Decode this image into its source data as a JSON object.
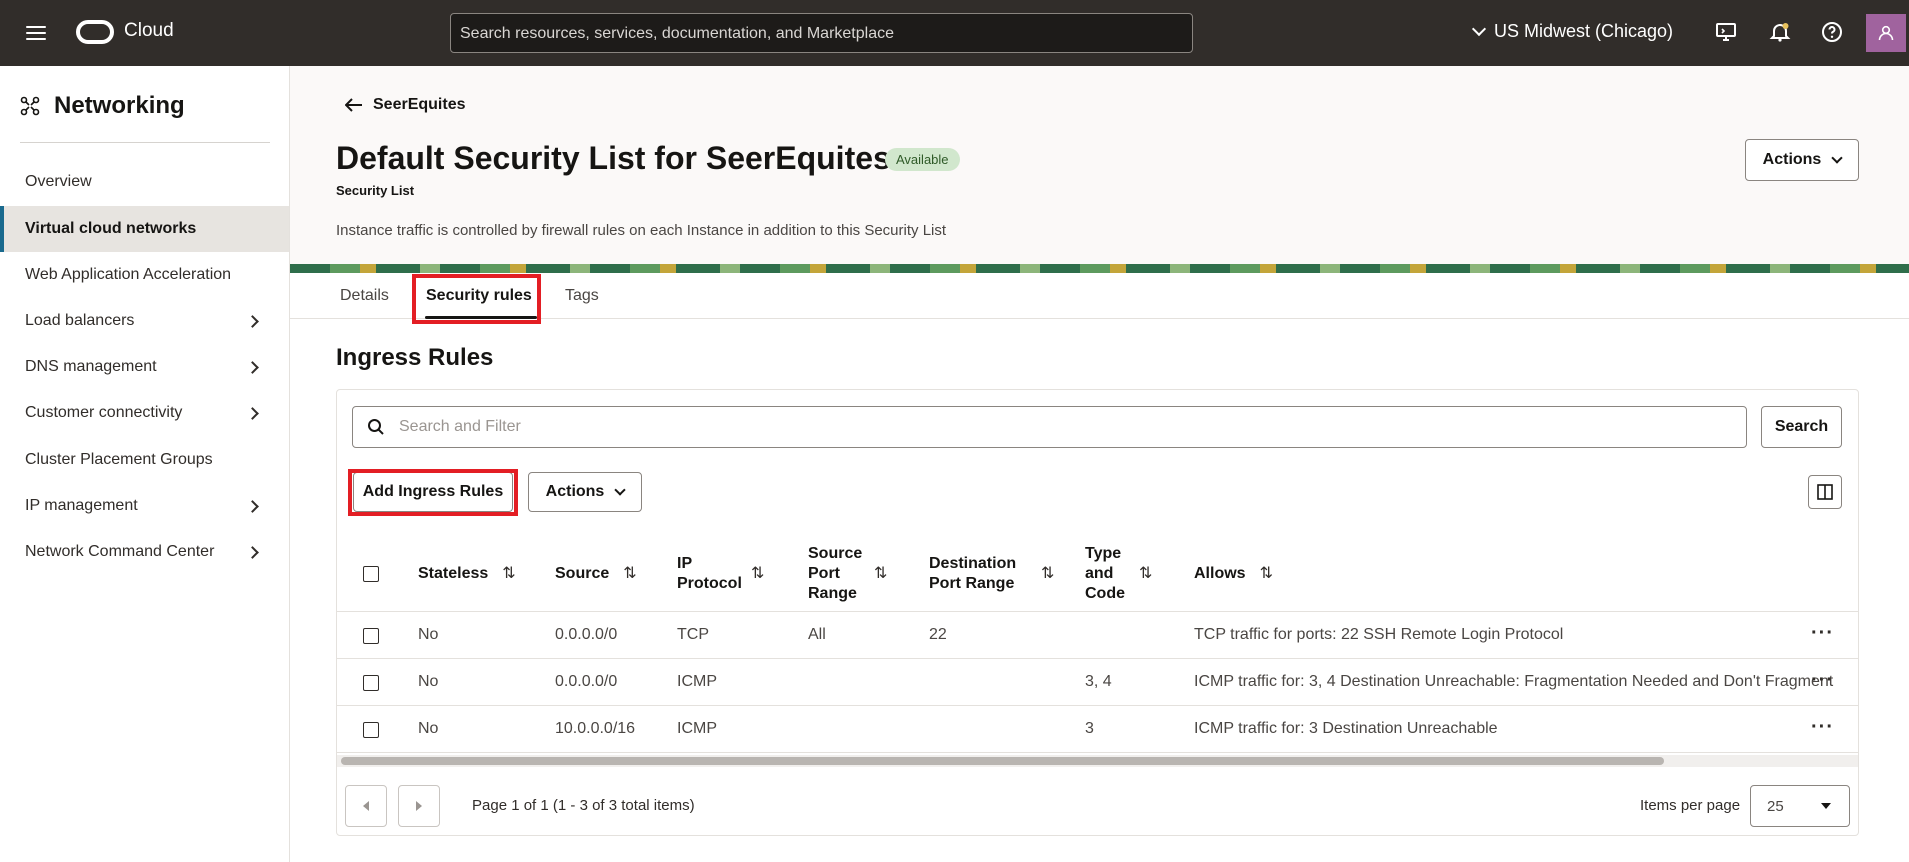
{
  "topbar": {
    "brand": "Cloud",
    "search_placeholder": "Search resources, services, documentation, and Marketplace",
    "region": "US Midwest (Chicago)"
  },
  "sidebar": {
    "title": "Networking",
    "items": [
      {
        "label": "Overview",
        "active": false,
        "has_submenu": false
      },
      {
        "label": "Virtual cloud networks",
        "active": true,
        "has_submenu": false
      },
      {
        "label": "Web Application Acceleration",
        "active": false,
        "has_submenu": false
      },
      {
        "label": "Load balancers",
        "active": false,
        "has_submenu": true
      },
      {
        "label": "DNS management",
        "active": false,
        "has_submenu": true
      },
      {
        "label": "Customer connectivity",
        "active": false,
        "has_submenu": true
      },
      {
        "label": "Cluster Placement Groups",
        "active": false,
        "has_submenu": false
      },
      {
        "label": "IP management",
        "active": false,
        "has_submenu": true
      },
      {
        "label": "Network Command Center",
        "active": false,
        "has_submenu": true
      }
    ]
  },
  "header": {
    "back_label": "SeerEquites",
    "title": "Default Security List for SeerEquites",
    "status": "Available",
    "subtitle": "Security List",
    "description": "Instance traffic is controlled by firewall rules on each Instance in addition to this Security List",
    "actions_label": "Actions"
  },
  "tabs": [
    {
      "label": "Details",
      "active": false
    },
    {
      "label": "Security rules",
      "active": true
    },
    {
      "label": "Tags",
      "active": false
    }
  ],
  "ingress": {
    "title": "Ingress Rules",
    "filter_placeholder": "Search and Filter",
    "search_label": "Search",
    "add_label": "Add Ingress Rules",
    "actions_label": "Actions",
    "columns": {
      "stateless": "Stateless",
      "source": "Source",
      "ip_protocol": "IP Protocol",
      "source_port_range": "Source Port Range",
      "destination_port_range": "Destination Port Range",
      "type_and_code": "Type and Code",
      "allows": "Allows"
    },
    "rows": [
      {
        "stateless": "No",
        "source": "0.0.0.0/0",
        "ip_protocol": "TCP",
        "source_port_range": "All",
        "destination_port_range": "22",
        "type_and_code": "",
        "allows": "TCP traffic for ports: 22 SSH Remote Login Protocol"
      },
      {
        "stateless": "No",
        "source": "0.0.0.0/0",
        "ip_protocol": "ICMP",
        "source_port_range": "",
        "destination_port_range": "",
        "type_and_code": "3, 4",
        "allows": "ICMP traffic for: 3, 4 Destination Unreachable: Fragmentation Needed and Don't Fragment"
      },
      {
        "stateless": "No",
        "source": "10.0.0.0/16",
        "ip_protocol": "ICMP",
        "source_port_range": "",
        "destination_port_range": "",
        "type_and_code": "3",
        "allows": "ICMP traffic for: 3 Destination Unreachable"
      }
    ],
    "pagination": {
      "info": "Page 1 of 1 (1 - 3 of 3 total items)",
      "items_per_page_label": "Items per page",
      "items_per_page": "25"
    }
  },
  "colors": {
    "topbar_bg": "#312d2a",
    "highlight_box": "#e31e24",
    "status_badge_bg": "#d1e7cd",
    "active_nav_border": "#1a6a8e"
  }
}
